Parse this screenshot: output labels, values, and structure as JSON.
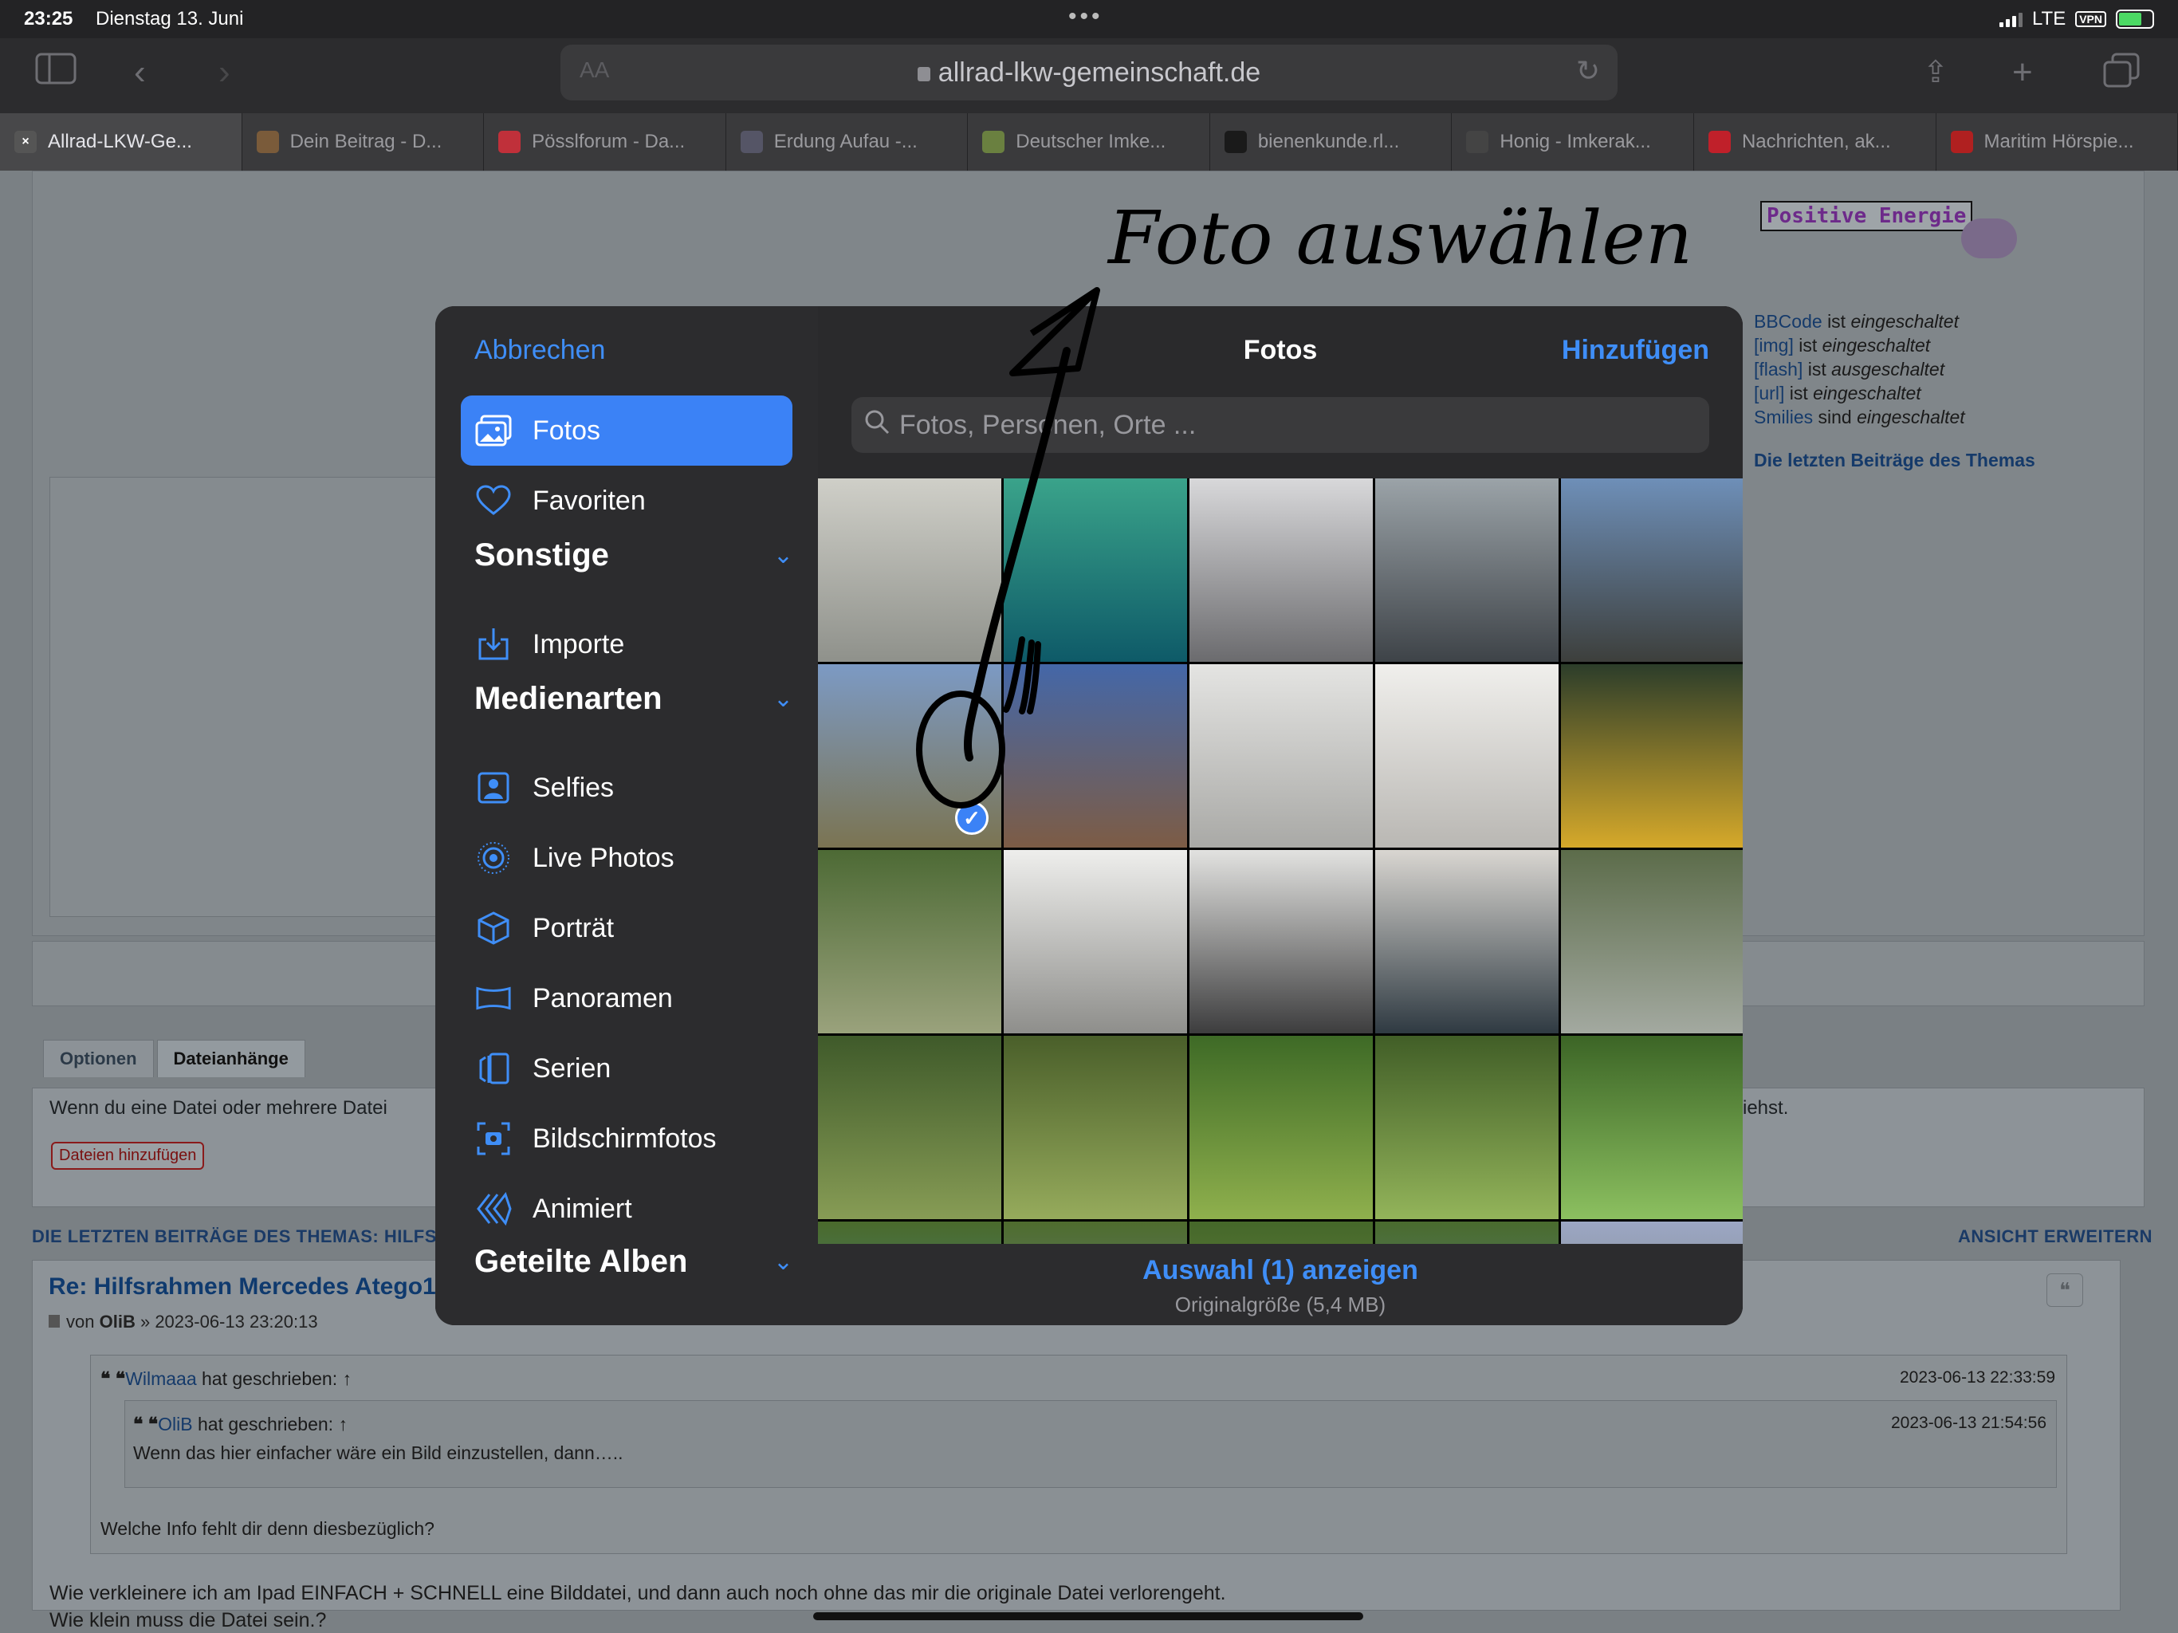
{
  "status": {
    "time": "23:25",
    "date": "Dienstag 13. Juni",
    "network": "LTE",
    "vpn": "VPN"
  },
  "browser": {
    "aa": "AA",
    "url": "allrad-lkw-gemeinschaft.de"
  },
  "tabs": [
    {
      "label": "Allrad-LKW-Ge...",
      "icon": "close-icon",
      "color": "#555"
    },
    {
      "label": "Dein Beitrag - D...",
      "icon": "forum-favicon",
      "color": "#7a5b3a"
    },
    {
      "label": "Pösslforum - Da...",
      "icon": "p-favicon",
      "color": "#c0303a"
    },
    {
      "label": "Erdung Aufau -...",
      "icon": "image-favicon",
      "color": "#556"
    },
    {
      "label": "Deutscher Imke...",
      "icon": "hex-favicon",
      "color": "#6a8040"
    },
    {
      "label": "bienenkunde.rl...",
      "icon": "rlp-favicon",
      "color": "#1a1a1a"
    },
    {
      "label": "Honig - Imkerak...",
      "icon": "i-favicon",
      "color": "#444"
    },
    {
      "label": "Nachrichten, ak...",
      "icon": "ntv-favicon",
      "color": "#c0202a"
    },
    {
      "label": "Maritim Hörspie...",
      "icon": "maritim-favicon",
      "color": "#b02020"
    }
  ],
  "forum": {
    "tab_options": "Optionen",
    "tab_attachments": "Dateianhänge",
    "attach_text_left": "Wenn du eine Datei oder mehrere Datei",
    "attach_text_right": "iehst.",
    "add_files": "Dateien hinzufügen",
    "latest_left": "DIE LETZTEN BEITRÄGE DES THEMAS: HILFSR",
    "latest_right": "ANSICHT ERWEITERN",
    "post_title": "Re: Hilfsrahmen Mercedes Atego10",
    "post_meta_prefix": "von",
    "post_author": "OliB",
    "post_meta_suffix": "» 2023-06-13 23:20:13",
    "q1_author": "Wilmaaa",
    "q1_suffix": "hat geschrieben: ↑",
    "q1_date": "2023-06-13 22:33:59",
    "q2_author": "OliB",
    "q2_suffix": "hat geschrieben: ↑",
    "q2_date": "2023-06-13 21:54:56",
    "q2_text": "Wenn das hier einfacher wäre ein Bild einzustellen, dann…..",
    "q1_text": "Welche Info fehlt dir denn diesbezüglich?",
    "body1": "Wie verkleinere ich am Ipad EINFACH + SCHNELL eine Bilddatei, und dann auch noch ohne das mir die originale Datei verlorengeht.",
    "body2": "Wie klein muss die Datei sein.?"
  },
  "side": {
    "badge": "Positive Energie",
    "lines": [
      {
        "k": "BBCode",
        "v": "ist",
        "s": "eingeschaltet"
      },
      {
        "k": "[img]",
        "v": "ist",
        "s": "eingeschaltet"
      },
      {
        "k": "[flash]",
        "v": "ist",
        "s": "ausgeschaltet"
      },
      {
        "k": "[url]",
        "v": "ist",
        "s": "eingeschaltet"
      },
      {
        "k": "Smilies",
        "v": "sind",
        "s": "eingeschaltet"
      }
    ],
    "latest": "Die letzten Beiträge des Themas"
  },
  "picker": {
    "cancel": "Abbrechen",
    "title": "Fotos",
    "add": "Hinzufügen",
    "search_placeholder": "Fotos, Personen, Orte ...",
    "selection": "Auswahl (1) anzeigen",
    "size": "Originalgröße (5,4 MB)",
    "sidebar": {
      "fotos": "Fotos",
      "favoriten": "Favoriten",
      "sonstige": "Sonstige",
      "importe": "Importe",
      "medienarten": "Medienarten",
      "selfies": "Selfies",
      "live": "Live Photos",
      "portrait": "Porträt",
      "panoramen": "Panoramen",
      "serien": "Serien",
      "bildschirmfotos": "Bildschirmfotos",
      "animiert": "Animiert",
      "geteilte": "Geteilte Alben"
    },
    "photos": [
      {
        "c1": "#cfcfc8",
        "c2": "#8f918b"
      },
      {
        "c1": "#3aa38a",
        "c2": "#0e5a68"
      },
      {
        "c1": "#d8d8da",
        "c2": "#6b6b6e"
      },
      {
        "c1": "#9ba3a8",
        "c2": "#3e4348"
      },
      {
        "c1": "#6e8fb8",
        "c2": "#3d3f3c"
      },
      {
        "c1": "#7c9ac4",
        "c2": "#7b7452"
      },
      {
        "c1": "#4467a8",
        "c2": "#7d5c45"
      },
      {
        "c1": "#e4e4e2",
        "c2": "#a9a9a6"
      },
      {
        "c1": "#f0efec",
        "c2": "#b9b7b3"
      },
      {
        "c1": "#2c3d2a",
        "c2": "#d6a92a"
      },
      {
        "c1": "#4d6a35",
        "c2": "#9aa27c"
      },
      {
        "c1": "#eeeeec",
        "c2": "#8e8e8b"
      },
      {
        "c1": "#e2e2e0",
        "c2": "#3d3d3e"
      },
      {
        "c1": "#d9d6d1",
        "c2": "#2f3a42"
      },
      {
        "c1": "#5c6c4a",
        "c2": "#a3a9a0"
      },
      {
        "c1": "#3f5a2a",
        "c2": "#879c55"
      },
      {
        "c1": "#4a5f2a",
        "c2": "#96ab5c"
      },
      {
        "c1": "#3e6a26",
        "c2": "#8fb04d"
      },
      {
        "c1": "#415e27",
        "c2": "#93b45a"
      },
      {
        "c1": "#3c6526",
        "c2": "#8cc060"
      },
      {
        "c1": "#4a6a2c",
        "c2": "#4b8fa0"
      },
      {
        "c1": "#4f6c2e",
        "c2": "#6a8aa0"
      },
      {
        "c1": "#45672a",
        "c2": "#7c9a4c"
      },
      {
        "c1": "#4a6b2e",
        "c2": "#5b8aa0"
      },
      {
        "c1": "#9ca6c4",
        "c2": "#6d7d64"
      }
    ]
  },
  "annotation": {
    "text": "Foto auswählen"
  }
}
